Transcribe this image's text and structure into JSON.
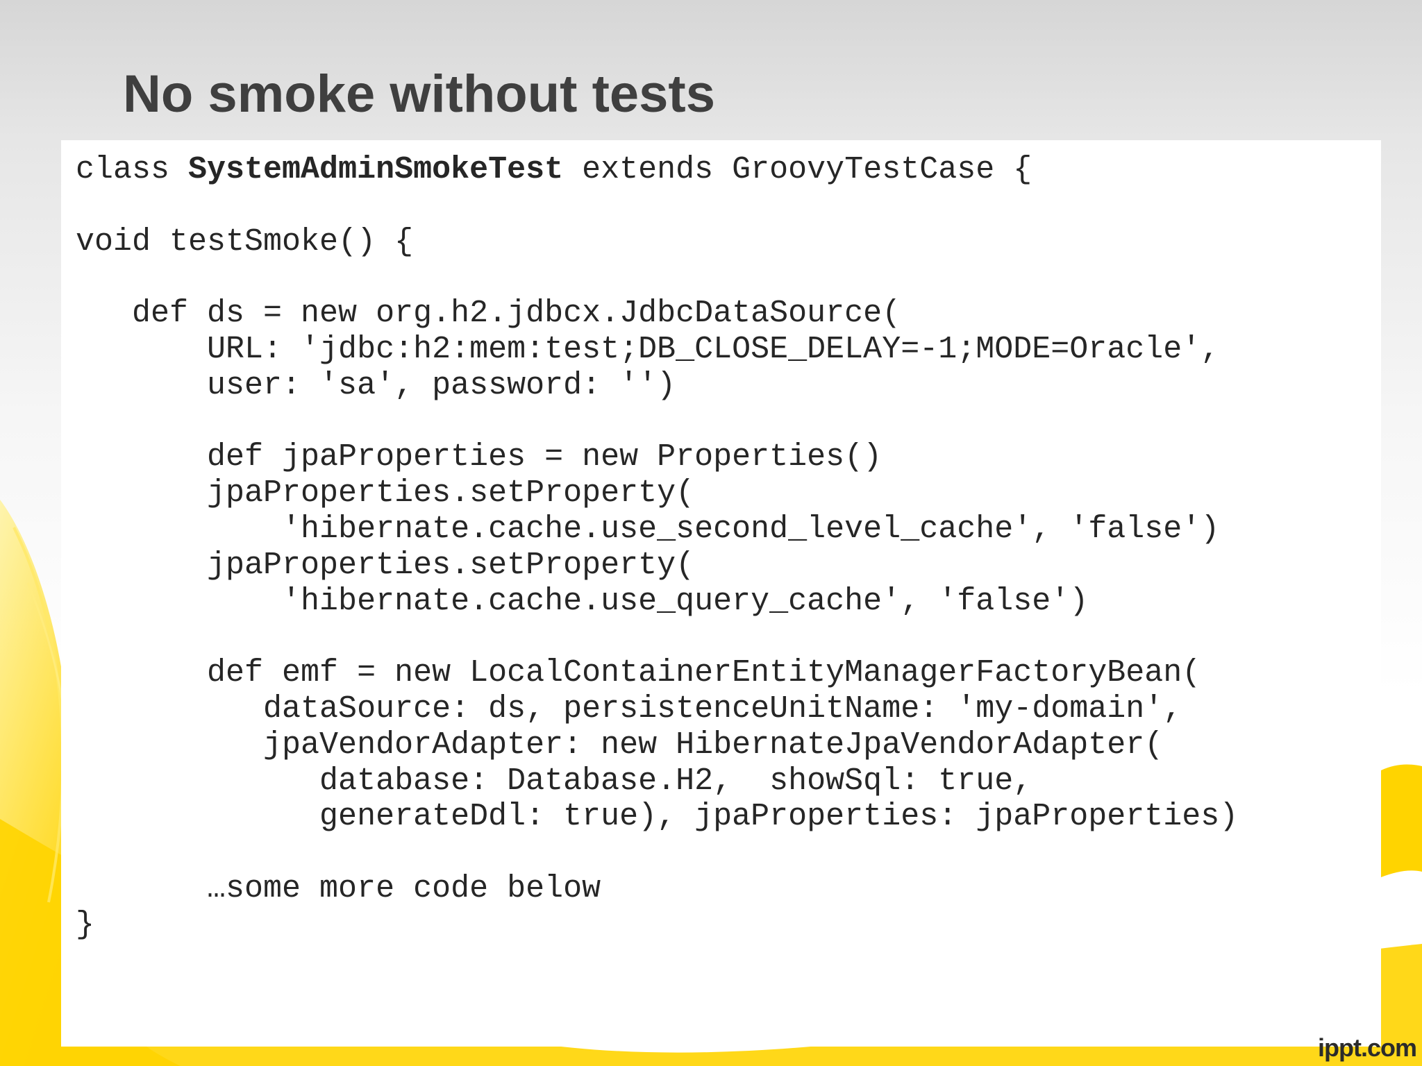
{
  "slide": {
    "title": "No smoke without tests",
    "background_accent": "#ffd400",
    "watermark": "ippt.com"
  },
  "code": {
    "lines": [
      {
        "pre": "class ",
        "bold": "SystemAdminSmokeTest",
        "post": " extends GroovyTestCase {"
      },
      {
        "text": ""
      },
      {
        "text": "void testSmoke() {"
      },
      {
        "text": ""
      },
      {
        "text": "   def ds = new org.h2.jdbcx.JdbcDataSource("
      },
      {
        "text": "       URL: 'jdbc:h2:mem:test;DB_CLOSE_DELAY=-1;MODE=Oracle',"
      },
      {
        "text": "       user: 'sa', password: '')"
      },
      {
        "text": ""
      },
      {
        "text": "       def jpaProperties = new Properties()"
      },
      {
        "text": "       jpaProperties.setProperty("
      },
      {
        "text": "           'hibernate.cache.use_second_level_cache', 'false')"
      },
      {
        "text": "       jpaProperties.setProperty("
      },
      {
        "text": "           'hibernate.cache.use_query_cache', 'false')"
      },
      {
        "text": ""
      },
      {
        "text": "       def emf = new LocalContainerEntityManagerFactoryBean("
      },
      {
        "text": "          dataSource: ds, persistenceUnitName: 'my-domain',"
      },
      {
        "text": "          jpaVendorAdapter: new HibernateJpaVendorAdapter("
      },
      {
        "text": "             database: Database.H2,  showSql: true,"
      },
      {
        "text": "             generateDdl: true), jpaProperties: jpaProperties)"
      },
      {
        "text": ""
      },
      {
        "text": "       …some more code below"
      },
      {
        "text": "}"
      }
    ]
  }
}
